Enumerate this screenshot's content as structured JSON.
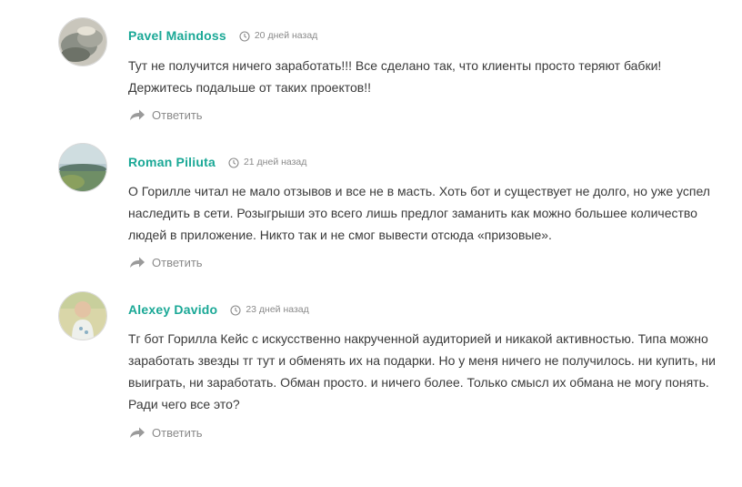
{
  "comments": [
    {
      "author": "Pavel Maindoss",
      "date": "20 дней назад",
      "text": "Тут не получится ничего заработать!!! Все сделано так, что клиенты просто теряют бабки! Держитесь подальше от таких проектов!!",
      "reply_label": "Ответить"
    },
    {
      "author": "Roman Piliuta",
      "date": "21 дней назад",
      "text": "О Горилле читал не мало отзывов и все не в масть. Хоть бот и существует не долго, но уже успел наследить в сети. Розыгрыши это всего лишь предлог заманить как можно большее количество людей в приложение. Никто так и не смог вывести отсюда «призовые».",
      "reply_label": "Ответить"
    },
    {
      "author": "Alexey Davido",
      "date": "23 дней назад",
      "text": "Тг бот Горилла Кейс с искусственно накрученной аудиторией и никакой активностью. Типа можно заработать звезды тг тут и обменять их на подарки. Но у меня ничего не получилось. ни купить, ни выиграть, ни заработать. Обман просто. и ничего более. Только смысл их обмана не могу понять. Ради чего все это?",
      "reply_label": "Ответить"
    }
  ],
  "colors": {
    "author": "#1aa896",
    "meta": "#8a8a8a",
    "text": "#3a3a3a"
  },
  "icons": {
    "date": "clock-icon",
    "reply": "reply-arrow-icon"
  }
}
